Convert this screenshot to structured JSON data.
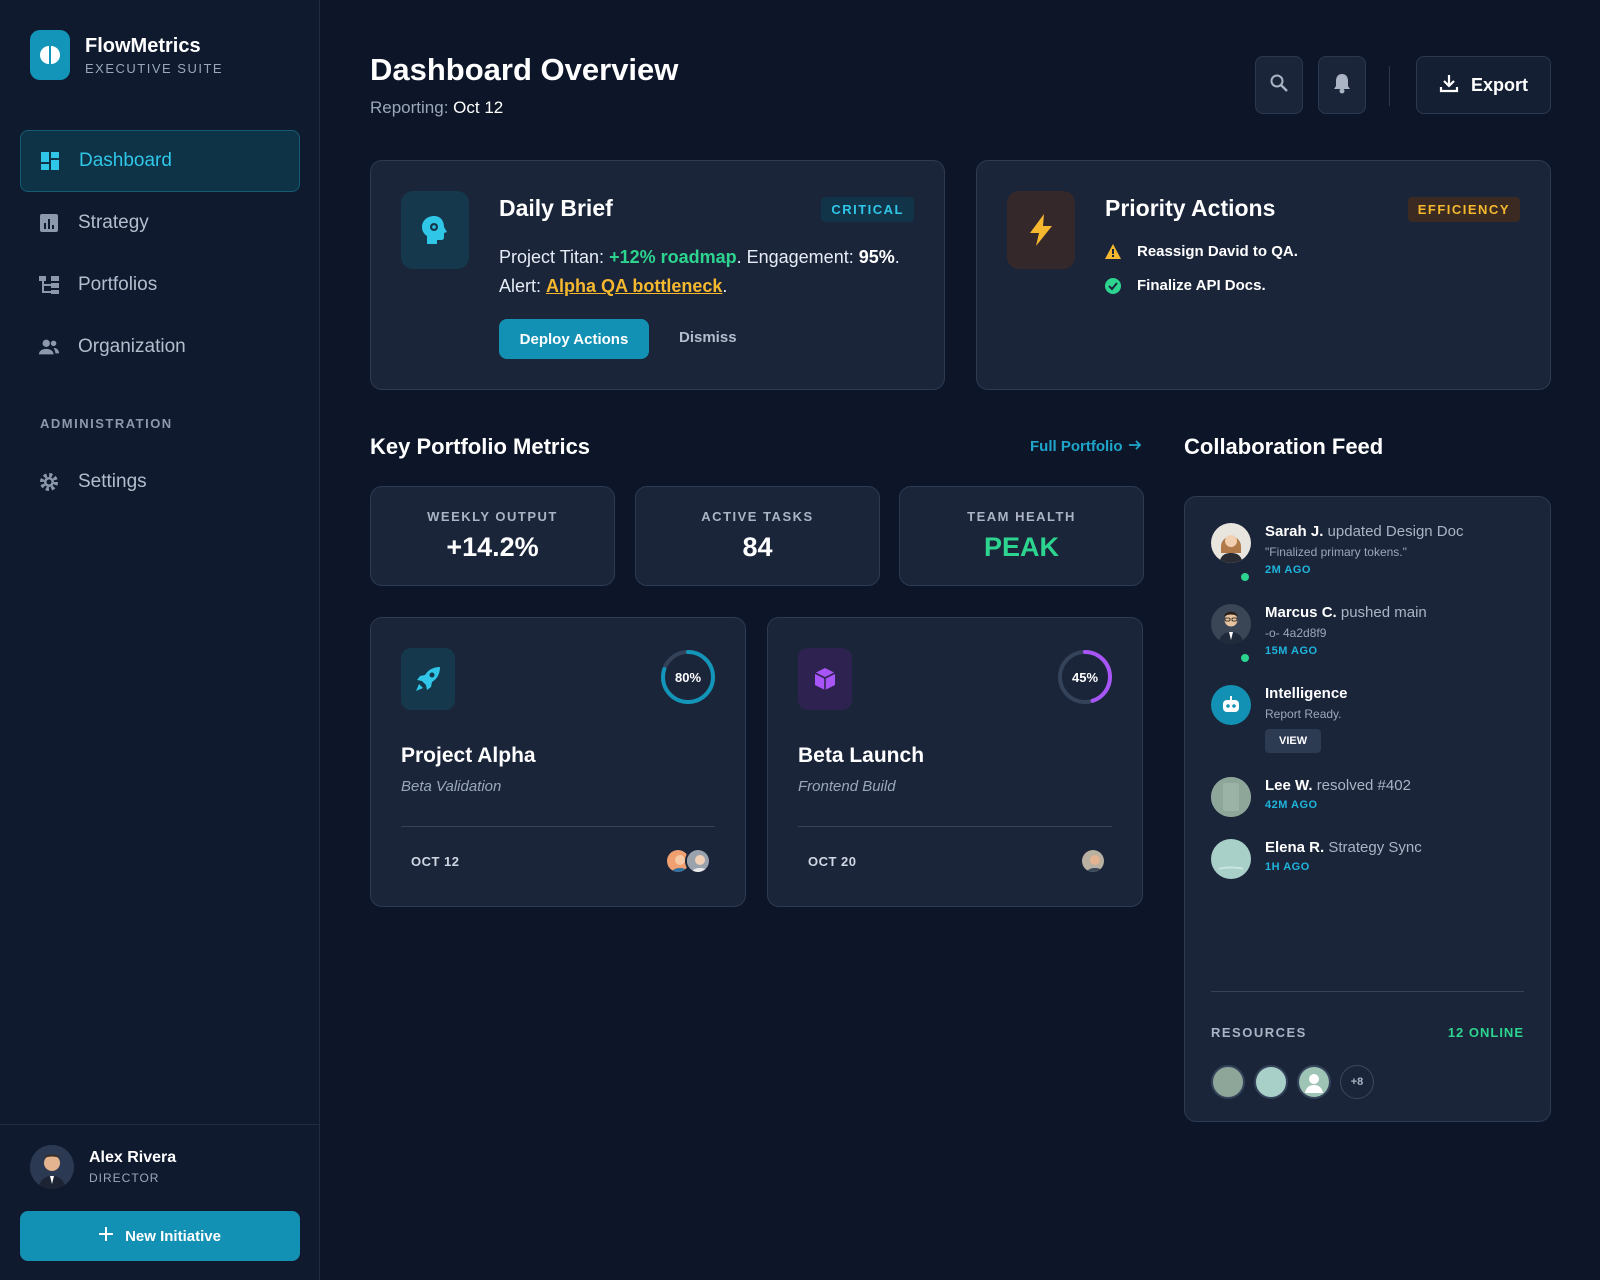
{
  "brand": {
    "name": "FlowMetrics",
    "subtitle": "EXECUTIVE SUITE",
    "logo_icon": "brain-icon",
    "color": "#1295b8"
  },
  "sidebar": {
    "items": [
      {
        "label": "Dashboard",
        "icon": "dashboard-icon",
        "active": true
      },
      {
        "label": "Strategy",
        "icon": "chart-icon"
      },
      {
        "label": "Portfolios",
        "icon": "hierarchy-icon"
      },
      {
        "label": "Organization",
        "icon": "people-icon"
      }
    ],
    "section_label": "ADMINISTRATION",
    "admin_items": [
      {
        "label": "Settings",
        "icon": "gear-icon"
      }
    ]
  },
  "user": {
    "name": "Alex Rivera",
    "role": "DIRECTOR"
  },
  "new_initiative_label": "New Initiative",
  "header": {
    "title": "Dashboard Overview",
    "reporting_label": "Reporting:",
    "reporting_value": "Oct 12",
    "export_label": "Export"
  },
  "daily_brief": {
    "title": "Daily Brief",
    "badge": "CRITICAL",
    "line1_prefix": "Project Titan: ",
    "line1_highlight": "+12% roadmap",
    "line1_mid": ". Engagement: ",
    "line1_value": "95%",
    "line1_end": ".",
    "line2_prefix": "Alert: ",
    "line2_highlight": "Alpha QA bottleneck",
    "line2_end": ".",
    "deploy_label": "Deploy Actions",
    "dismiss_label": "Dismiss"
  },
  "priority_actions": {
    "title": "Priority Actions",
    "badge": "EFFICIENCY",
    "items": [
      {
        "label": "Reassign David to QA.",
        "icon": "warning-icon"
      },
      {
        "label": "Finalize API Docs.",
        "icon": "check-circle-icon"
      }
    ]
  },
  "metrics": {
    "title": "Key Portfolio Metrics",
    "link_label": "Full Portfolio",
    "cards": [
      {
        "label": "WEEKLY OUTPUT",
        "value": "+14.2%"
      },
      {
        "label": "ACTIVE TASKS",
        "value": "84"
      },
      {
        "label": "TEAM HEALTH",
        "value": "PEAK"
      }
    ]
  },
  "projects": [
    {
      "name": "Project Alpha",
      "subtitle": "Beta Validation",
      "progress": 80,
      "progress_label": "80%",
      "date": "OCT 12",
      "icon": "rocket-icon",
      "color": "#1295b8"
    },
    {
      "name": "Beta Launch",
      "subtitle": "Frontend Build",
      "progress": 45,
      "progress_label": "45%",
      "date": "OCT 20",
      "icon": "cube-icon",
      "color": "#a855f7"
    }
  ],
  "feed": {
    "title": "Collaboration Feed",
    "items": [
      {
        "name": "Sarah J.",
        "action": "updated Design Doc",
        "meta": "\"Finalized primary tokens.\"",
        "time": "2M AGO"
      },
      {
        "name": "Marcus C.",
        "action": "pushed main",
        "meta": "-o- 4a2d8f9",
        "time": "15M AGO"
      },
      {
        "name": "Intelligence",
        "action": "",
        "meta": "Report Ready.",
        "button": "VIEW"
      },
      {
        "name": "Lee W.",
        "action": "resolved #402",
        "time": "42M AGO"
      },
      {
        "name": "Elena R.",
        "action": "Strategy Sync",
        "time": "1H AGO"
      }
    ],
    "resources_label": "RESOURCES",
    "online_label": "12 ONLINE",
    "more_label": "+8"
  }
}
